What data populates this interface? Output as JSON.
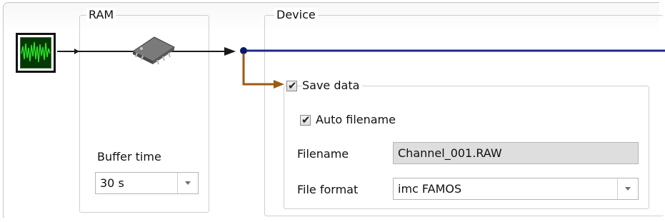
{
  "ram": {
    "title": "RAM",
    "buffer_time_label": "Buffer time",
    "buffer_time_value": "30 s"
  },
  "device": {
    "title": "Device",
    "save_data": {
      "label": "Save data",
      "checked": true
    },
    "auto_filename": {
      "label": "Auto filename",
      "checked": true
    },
    "filename_label": "Filename",
    "filename_value": "Channel_001.RAW",
    "file_format_label": "File format",
    "file_format_value": "imc FAMOS"
  },
  "icons": {
    "signal": "signal-waveform-icon",
    "ram_chip": "ram-chip-icon",
    "checkmark": "checkmark-icon",
    "dropdown": "chevron-down-icon"
  },
  "colors": {
    "signal_line": "#1a1a1a",
    "data_bus": "#1c2b8a",
    "save_branch": "#9c5a14",
    "waveform": "#29e629"
  }
}
